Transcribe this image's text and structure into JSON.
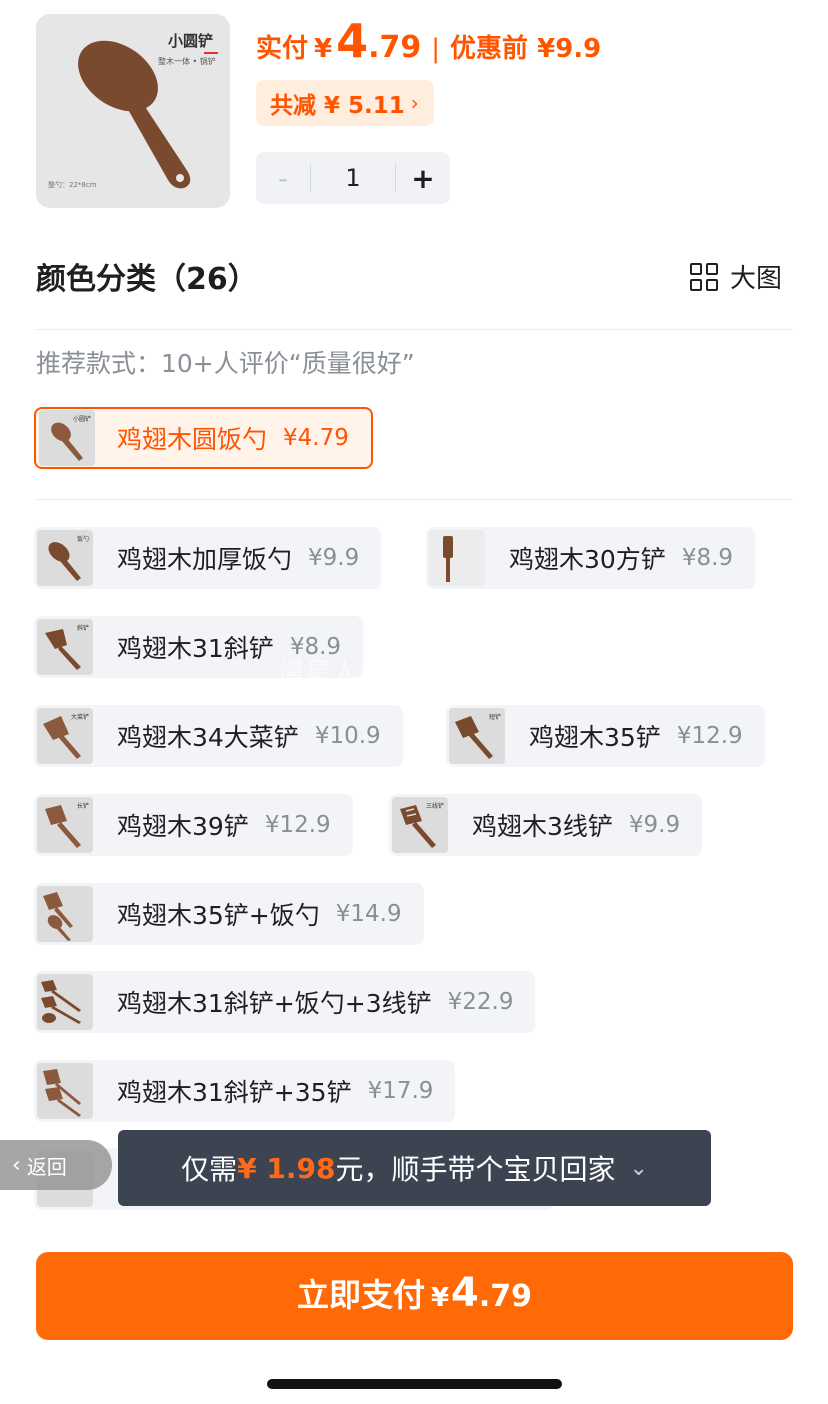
{
  "product": {
    "thumb_title": "小圆铲",
    "thumb_subtitle": "整木一体 • 锅铲",
    "thumb_size": "整勺：22*8cm",
    "price_label": "实付",
    "currency": "¥",
    "price_int": "4",
    "price_dec": ".79",
    "separator": "|",
    "original_price": "优惠前 ¥9.9",
    "discount_label": "共减 ¥ 5.11",
    "discount_chevron": "›",
    "quantity": "1",
    "minus": "-",
    "plus": "+"
  },
  "section": {
    "title": "颜色分类（26）",
    "big_image_label": "大图",
    "recommend_text": "推荐款式：10+人评价“质量很好”"
  },
  "selected_option": {
    "name": "鸡翅木圆饭勺",
    "price": "¥4.79"
  },
  "options": [
    {
      "name": "鸡翅木加厚饭勺",
      "price": "¥9.9"
    },
    {
      "name": "鸡翅木30方铲",
      "price": "¥8.9"
    },
    {
      "name": "鸡翅木31斜铲",
      "price": "¥8.9"
    },
    {
      "name": "鸡翅木34大菜铲",
      "price": "¥10.9"
    },
    {
      "name": "鸡翅木35铲",
      "price": "¥12.9"
    },
    {
      "name": "鸡翅木39铲",
      "price": "¥12.9"
    },
    {
      "name": "鸡翅木3线铲",
      "price": "¥9.9"
    },
    {
      "name": "鸡翅木35铲+饭勺",
      "price": "¥14.9"
    },
    {
      "name": "鸡翅木31斜铲+饭勺+3线铲",
      "price": "¥22.9"
    },
    {
      "name": "鸡翅木31斜铲+35铲",
      "price": "¥17.9"
    }
  ],
  "thumb_labels": [
    "小圆铲",
    "饭勺",
    "",
    "斜铲",
    "大菜铲",
    "短铲",
    "长铲",
    "三线铲",
    "",
    "",
    ""
  ],
  "watermark": "慢星人4630423SK",
  "back_button": {
    "chevron": "‹",
    "label": "返回"
  },
  "toast": {
    "prefix": "仅需",
    "highlight": "¥ 1.98",
    "suffix": "元，顺手带个宝贝回家",
    "chevron": "⌄"
  },
  "pay_button": {
    "label": "立即支付",
    "currency": "¥",
    "price_int": "4",
    "price_dec": ".79"
  },
  "colors": {
    "accent": "#ff5500",
    "button": "#ff6a07",
    "chip_bg": "#f2f4f7",
    "wood": "#8b5a3c"
  }
}
